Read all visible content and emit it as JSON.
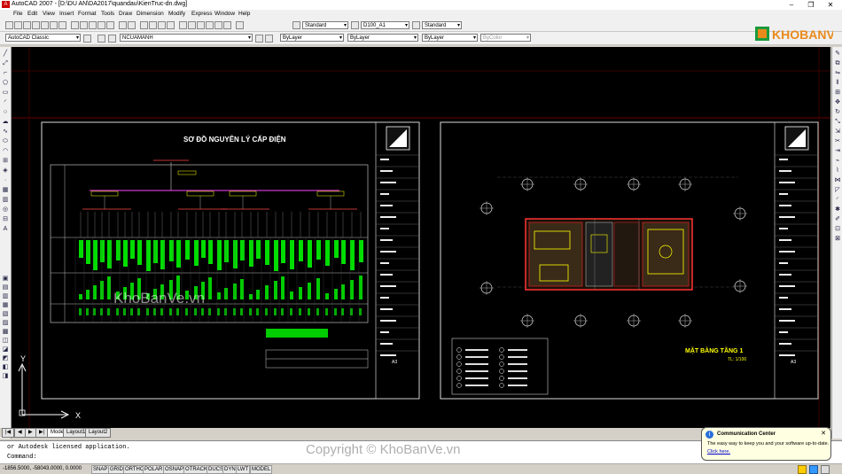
{
  "window": {
    "title": "AutoCAD 2007 - [D:\\DU AN\\DA2017\\quandau\\KienTruc-dn.dwg]",
    "minimize": "–",
    "maximize": "❐",
    "close": "✕"
  },
  "menu": [
    "File",
    "Edit",
    "View",
    "Insert",
    "Format",
    "Tools",
    "Draw",
    "Dimension",
    "Modify",
    "Express",
    "Window",
    "Help"
  ],
  "toolbar": {
    "text_style": "Standard",
    "dim_style": "D100_A1",
    "table_style": "Standard",
    "workspace": "AutoCAD Classic",
    "layer": "NCUAMANH",
    "color": "ByLayer",
    "linetype": "ByLayer",
    "lineweight": "ByLayer",
    "plotstyle": "ByColor"
  },
  "watermark": {
    "brand": "KHOBANVE",
    "site": "KhoBanVe.vn",
    "copyright": "Copyright © KhoBanVe.vn"
  },
  "drawing": {
    "left_title": "SƠ ĐỒ NGUYÊN LÝ CẤP ĐIỆN",
    "right_title": "MẶT BẰNG TẦNG 1",
    "right_scale": "TL: 1/100",
    "sheet_code": "A3"
  },
  "ucs": {
    "x": "X",
    "y": "Y"
  },
  "tabs": [
    "Model",
    "Layout1",
    "Layout2"
  ],
  "command": {
    "line1": "or Autodesk licensed application.",
    "line2": "Command:"
  },
  "status": {
    "coords": "-1856.5000, -58043.0000, 0.0000",
    "toggles": [
      "SNAP",
      "GRID",
      "ORTHO",
      "POLAR",
      "OSNAP",
      "OTRACK",
      "DUCS",
      "DYN",
      "LWT",
      "MODEL"
    ]
  },
  "balloon": {
    "title": "Communication Center",
    "body": "The easy way to keep you and your software up-to-date.",
    "link": "Click here."
  },
  "colors": {
    "accent_green": "#00ff00",
    "accent_yellow": "#ffff00",
    "accent_magenta": "#ff00ff",
    "logo_orange": "#e98a1c",
    "logo_green": "#1a9a3c"
  }
}
